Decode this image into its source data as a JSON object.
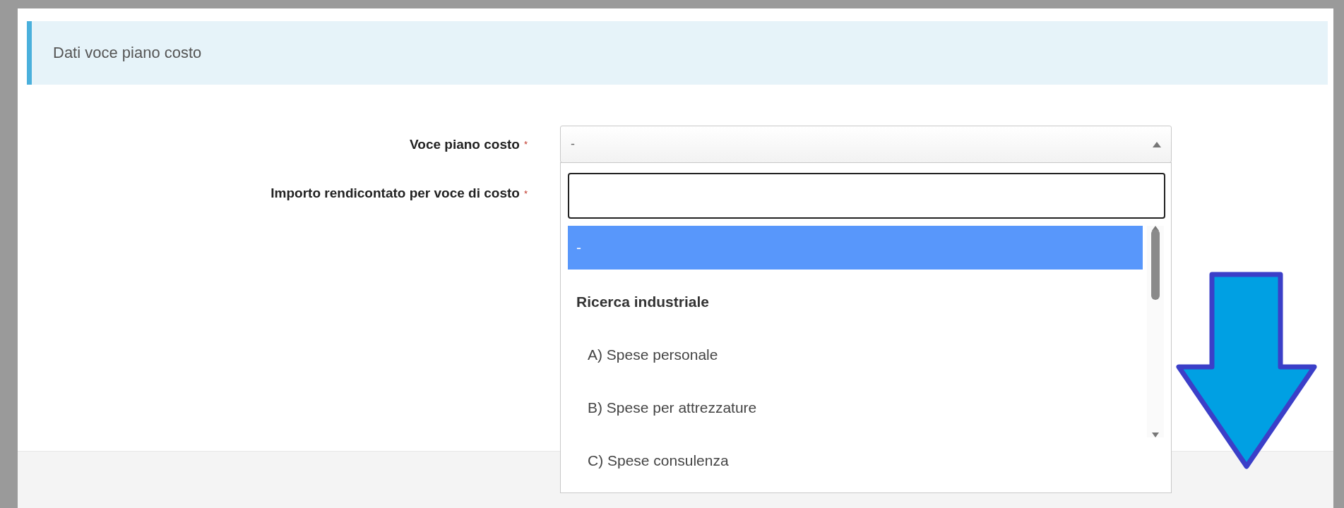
{
  "section_title": "Dati voce piano costo",
  "voce_field": {
    "label": "Voce piano costo",
    "required_mark": "*",
    "value": "-",
    "expanded": true,
    "options": [
      {
        "kind": "option",
        "label": "-",
        "selected": true
      },
      {
        "kind": "group",
        "label": "Ricerca industriale",
        "selected": false
      },
      {
        "kind": "option",
        "label": "A) Spese personale",
        "selected": false
      },
      {
        "kind": "option",
        "label": "B) Spese per attrezzature",
        "selected": false
      },
      {
        "kind": "option",
        "label": "C) Spese consulenza",
        "selected": false
      }
    ]
  },
  "importo_field": {
    "label": "Importo rendicontato per voce di costo",
    "required_mark": "*"
  }
}
